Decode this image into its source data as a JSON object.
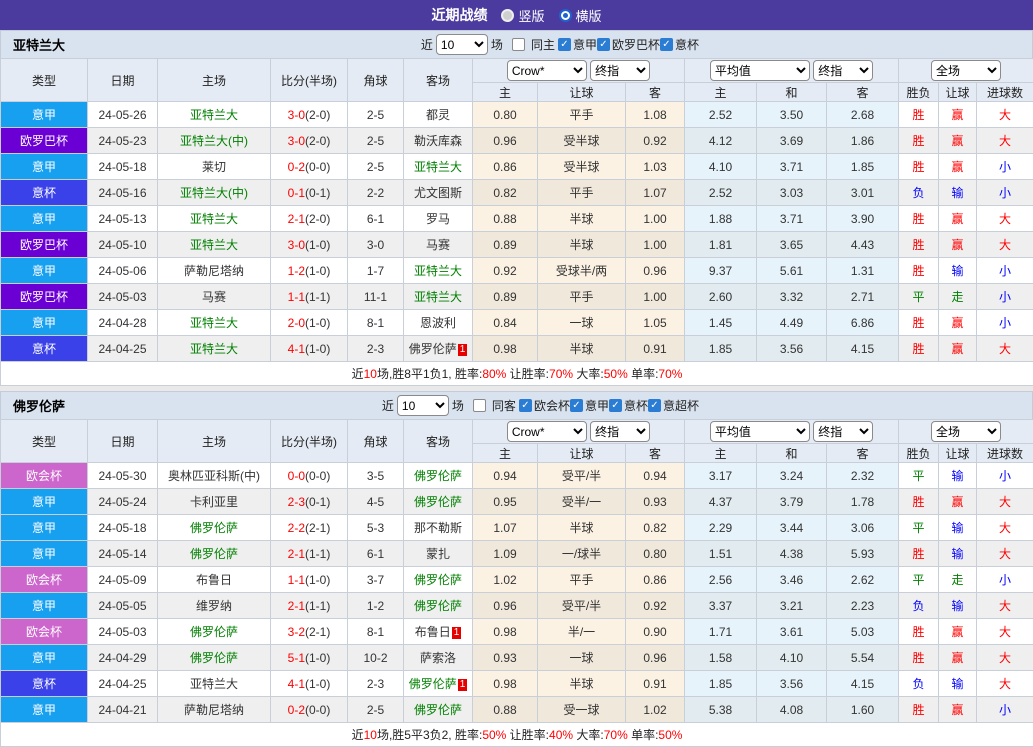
{
  "titlebar": {
    "title": "近期战绩",
    "radio_vertical": "竖版",
    "radio_horizontal": "横版",
    "bar_color": "#4c3b9e"
  },
  "controls": {
    "near_label": "近",
    "rounds_value": "10",
    "matches_label": "场",
    "odds_source": "Crow*",
    "odds_stage": "终指",
    "avg_source": "平均值",
    "avg_stage": "终指",
    "scope": "全场"
  },
  "columns": {
    "type": "类型",
    "date": "日期",
    "home": "主场",
    "score": "比分(半场)",
    "corner": "角球",
    "away": "客场",
    "odds_home": "主",
    "odds_handicap": "让球",
    "odds_away": "客",
    "avg_home": "主",
    "avg_draw": "和",
    "avg_away": "客",
    "res_wdl": "胜负",
    "res_handicap": "让球",
    "res_goals": "进球数"
  },
  "league_colors": {
    "意甲": "#18a0f0",
    "欧罗巴杯": "#6b00d4",
    "意杯": "#3a41e8",
    "欧会杯": "#cc66cc"
  },
  "result_colors": {
    "胜": "#ff0000",
    "负": "#0000ff",
    "平": "#008000",
    "赢": "#ff0000",
    "输": "#0000ff",
    "走": "#008000",
    "大": "#ff0000",
    "小": "#0000ff"
  },
  "team_green": "#008000",
  "score_red": "#ff0000",
  "sections": [
    {
      "team": "亚特兰大",
      "same_venue_label": "同主",
      "league_filters": [
        "意甲",
        "欧罗巴杯",
        "意杯"
      ],
      "rows": [
        {
          "league": "意甲",
          "date": "24-05-26",
          "home": "亚特兰大",
          "hg": 1,
          "score": "3-0",
          "half": "2-0",
          "corner": "2-5",
          "away": "都灵",
          "ag": 0,
          "badge": "",
          "o1": "0.80",
          "hc": "平手",
          "o2": "1.08",
          "a1": "2.52",
          "a2": "3.50",
          "a3": "2.68",
          "r1": "胜",
          "r2": "赢",
          "r3": "大"
        },
        {
          "league": "欧罗巴杯",
          "date": "24-05-23",
          "home": "亚特兰大(中)",
          "hg": 1,
          "score": "3-0",
          "half": "2-0",
          "corner": "2-5",
          "away": "勒沃库森",
          "ag": 0,
          "badge": "",
          "o1": "0.96",
          "hc": "受半球",
          "o2": "0.92",
          "a1": "4.12",
          "a2": "3.69",
          "a3": "1.86",
          "r1": "胜",
          "r2": "赢",
          "r3": "大"
        },
        {
          "league": "意甲",
          "date": "24-05-18",
          "home": "莱切",
          "hg": 0,
          "score": "0-2",
          "half": "0-0",
          "corner": "2-5",
          "away": "亚特兰大",
          "ag": 1,
          "badge": "",
          "o1": "0.86",
          "hc": "受半球",
          "o2": "1.03",
          "a1": "4.10",
          "a2": "3.71",
          "a3": "1.85",
          "r1": "胜",
          "r2": "赢",
          "r3": "小"
        },
        {
          "league": "意杯",
          "date": "24-05-16",
          "home": "亚特兰大(中)",
          "hg": 1,
          "score": "0-1",
          "half": "0-1",
          "corner": "2-2",
          "away": "尤文图斯",
          "ag": 0,
          "badge": "",
          "o1": "0.82",
          "hc": "平手",
          "o2": "1.07",
          "a1": "2.52",
          "a2": "3.03",
          "a3": "3.01",
          "r1": "负",
          "r2": "输",
          "r3": "小"
        },
        {
          "league": "意甲",
          "date": "24-05-13",
          "home": "亚特兰大",
          "hg": 1,
          "score": "2-1",
          "half": "2-0",
          "corner": "6-1",
          "away": "罗马",
          "ag": 0,
          "badge": "",
          "o1": "0.88",
          "hc": "半球",
          "o2": "1.00",
          "a1": "1.88",
          "a2": "3.71",
          "a3": "3.90",
          "r1": "胜",
          "r2": "赢",
          "r3": "大"
        },
        {
          "league": "欧罗巴杯",
          "date": "24-05-10",
          "home": "亚特兰大",
          "hg": 1,
          "score": "3-0",
          "half": "1-0",
          "corner": "3-0",
          "away": "马赛",
          "ag": 0,
          "badge": "",
          "o1": "0.89",
          "hc": "半球",
          "o2": "1.00",
          "a1": "1.81",
          "a2": "3.65",
          "a3": "4.43",
          "r1": "胜",
          "r2": "赢",
          "r3": "大"
        },
        {
          "league": "意甲",
          "date": "24-05-06",
          "home": "萨勒尼塔纳",
          "hg": 0,
          "score": "1-2",
          "half": "1-0",
          "corner": "1-7",
          "away": "亚特兰大",
          "ag": 1,
          "badge": "",
          "o1": "0.92",
          "hc": "受球半/两",
          "o2": "0.96",
          "a1": "9.37",
          "a2": "5.61",
          "a3": "1.31",
          "r1": "胜",
          "r2": "输",
          "r3": "小"
        },
        {
          "league": "欧罗巴杯",
          "date": "24-05-03",
          "home": "马赛",
          "hg": 0,
          "score": "1-1",
          "half": "1-1",
          "corner": "11-1",
          "away": "亚特兰大",
          "ag": 1,
          "badge": "",
          "o1": "0.89",
          "hc": "平手",
          "o2": "1.00",
          "a1": "2.60",
          "a2": "3.32",
          "a3": "2.71",
          "r1": "平",
          "r2": "走",
          "r3": "小"
        },
        {
          "league": "意甲",
          "date": "24-04-28",
          "home": "亚特兰大",
          "hg": 1,
          "score": "2-0",
          "half": "1-0",
          "corner": "8-1",
          "away": "恩波利",
          "ag": 0,
          "badge": "",
          "o1": "0.84",
          "hc": "一球",
          "o2": "1.05",
          "a1": "1.45",
          "a2": "4.49",
          "a3": "6.86",
          "r1": "胜",
          "r2": "赢",
          "r3": "小"
        },
        {
          "league": "意杯",
          "date": "24-04-25",
          "home": "亚特兰大",
          "hg": 1,
          "score": "4-1",
          "half": "1-0",
          "corner": "2-3",
          "away": "佛罗伦萨",
          "ag": 0,
          "badge": "1",
          "o1": "0.98",
          "hc": "半球",
          "o2": "0.91",
          "a1": "1.85",
          "a2": "3.56",
          "a3": "4.15",
          "r1": "胜",
          "r2": "赢",
          "r3": "大"
        }
      ],
      "summary": [
        {
          "t": "近"
        },
        {
          "t": "10",
          "r": 1
        },
        {
          "t": "场,胜8平1负1, 胜率:"
        },
        {
          "t": "80%",
          "r": 1
        },
        {
          "t": " 让胜率:"
        },
        {
          "t": "70%",
          "r": 1
        },
        {
          "t": " 大率:"
        },
        {
          "t": "50%",
          "r": 1
        },
        {
          "t": " 单率:"
        },
        {
          "t": "70%",
          "r": 1
        }
      ]
    },
    {
      "team": "佛罗伦萨",
      "same_venue_label": "同客",
      "league_filters": [
        "欧会杯",
        "意甲",
        "意杯",
        "意超杯"
      ],
      "rows": [
        {
          "league": "欧会杯",
          "date": "24-05-30",
          "home": "奥林匹亚科斯(中)",
          "hg": 0,
          "score": "0-0",
          "half": "0-0",
          "corner": "3-5",
          "away": "佛罗伦萨",
          "ag": 1,
          "badge": "",
          "o1": "0.94",
          "hc": "受平/半",
          "o2": "0.94",
          "a1": "3.17",
          "a2": "3.24",
          "a3": "2.32",
          "r1": "平",
          "r2": "输",
          "r3": "小"
        },
        {
          "league": "意甲",
          "date": "24-05-24",
          "home": "卡利亚里",
          "hg": 0,
          "score": "2-3",
          "half": "0-1",
          "corner": "4-5",
          "away": "佛罗伦萨",
          "ag": 1,
          "badge": "",
          "o1": "0.95",
          "hc": "受半/一",
          "o2": "0.93",
          "a1": "4.37",
          "a2": "3.79",
          "a3": "1.78",
          "r1": "胜",
          "r2": "赢",
          "r3": "大"
        },
        {
          "league": "意甲",
          "date": "24-05-18",
          "home": "佛罗伦萨",
          "hg": 1,
          "score": "2-2",
          "half": "2-1",
          "corner": "5-3",
          "away": "那不勒斯",
          "ag": 0,
          "badge": "",
          "o1": "1.07",
          "hc": "半球",
          "o2": "0.82",
          "a1": "2.29",
          "a2": "3.44",
          "a3": "3.06",
          "r1": "平",
          "r2": "输",
          "r3": "大"
        },
        {
          "league": "意甲",
          "date": "24-05-14",
          "home": "佛罗伦萨",
          "hg": 1,
          "score": "2-1",
          "half": "1-1",
          "corner": "6-1",
          "away": "蒙扎",
          "ag": 0,
          "badge": "",
          "o1": "1.09",
          "hc": "一/球半",
          "o2": "0.80",
          "a1": "1.51",
          "a2": "4.38",
          "a3": "5.93",
          "r1": "胜",
          "r2": "输",
          "r3": "大"
        },
        {
          "league": "欧会杯",
          "date": "24-05-09",
          "home": "布鲁日",
          "hg": 0,
          "score": "1-1",
          "half": "1-0",
          "corner": "3-7",
          "away": "佛罗伦萨",
          "ag": 1,
          "badge": "",
          "o1": "1.02",
          "hc": "平手",
          "o2": "0.86",
          "a1": "2.56",
          "a2": "3.46",
          "a3": "2.62",
          "r1": "平",
          "r2": "走",
          "r3": "小"
        },
        {
          "league": "意甲",
          "date": "24-05-05",
          "home": "维罗纳",
          "hg": 0,
          "score": "2-1",
          "half": "1-1",
          "corner": "1-2",
          "away": "佛罗伦萨",
          "ag": 1,
          "badge": "",
          "o1": "0.96",
          "hc": "受平/半",
          "o2": "0.92",
          "a1": "3.37",
          "a2": "3.21",
          "a3": "2.23",
          "r1": "负",
          "r2": "输",
          "r3": "大"
        },
        {
          "league": "欧会杯",
          "date": "24-05-03",
          "home": "佛罗伦萨",
          "hg": 1,
          "score": "3-2",
          "half": "2-1",
          "corner": "8-1",
          "away": "布鲁日",
          "ag": 0,
          "badge": "1",
          "o1": "0.98",
          "hc": "半/一",
          "o2": "0.90",
          "a1": "1.71",
          "a2": "3.61",
          "a3": "5.03",
          "r1": "胜",
          "r2": "赢",
          "r3": "大"
        },
        {
          "league": "意甲",
          "date": "24-04-29",
          "home": "佛罗伦萨",
          "hg": 1,
          "score": "5-1",
          "half": "1-0",
          "corner": "10-2",
          "away": "萨索洛",
          "ag": 0,
          "badge": "",
          "o1": "0.93",
          "hc": "一球",
          "o2": "0.96",
          "a1": "1.58",
          "a2": "4.10",
          "a3": "5.54",
          "r1": "胜",
          "r2": "赢",
          "r3": "大"
        },
        {
          "league": "意杯",
          "date": "24-04-25",
          "home": "亚特兰大",
          "hg": 0,
          "score": "4-1",
          "half": "1-0",
          "corner": "2-3",
          "away": "佛罗伦萨",
          "ag": 1,
          "badge": "1",
          "o1": "0.98",
          "hc": "半球",
          "o2": "0.91",
          "a1": "1.85",
          "a2": "3.56",
          "a3": "4.15",
          "r1": "负",
          "r2": "输",
          "r3": "大"
        },
        {
          "league": "意甲",
          "date": "24-04-21",
          "home": "萨勒尼塔纳",
          "hg": 0,
          "score": "0-2",
          "half": "0-0",
          "corner": "2-5",
          "away": "佛罗伦萨",
          "ag": 1,
          "badge": "",
          "o1": "0.88",
          "hc": "受一球",
          "o2": "1.02",
          "a1": "5.38",
          "a2": "4.08",
          "a3": "1.60",
          "r1": "胜",
          "r2": "赢",
          "r3": "小"
        }
      ],
      "summary": [
        {
          "t": "近"
        },
        {
          "t": "10",
          "r": 1
        },
        {
          "t": "场,胜5平3负2, 胜率:"
        },
        {
          "t": "50%",
          "r": 1
        },
        {
          "t": " 让胜率:"
        },
        {
          "t": "40%",
          "r": 1
        },
        {
          "t": " 大率:"
        },
        {
          "t": "70%",
          "r": 1
        },
        {
          "t": " 单率:"
        },
        {
          "t": "50%",
          "r": 1
        }
      ]
    }
  ]
}
